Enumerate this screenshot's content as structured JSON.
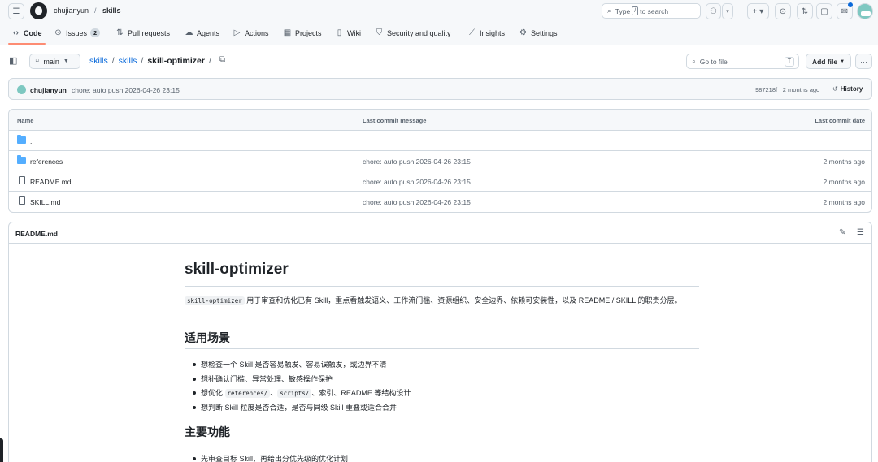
{
  "header": {
    "owner": "chujianyun",
    "separator": "/",
    "repo": "skills",
    "search_prefix": "Type",
    "search_key": "/",
    "search_suffix": "to search"
  },
  "tabs": [
    {
      "label": "Code",
      "icon": "code-icon"
    },
    {
      "label": "Issues",
      "icon": "issue-icon",
      "count": "2"
    },
    {
      "label": "Pull requests",
      "icon": "pull-request-icon"
    },
    {
      "label": "Agents",
      "icon": "agent-icon"
    },
    {
      "label": "Actions",
      "icon": "play-icon"
    },
    {
      "label": "Projects",
      "icon": "table-icon"
    },
    {
      "label": "Wiki",
      "icon": "book-icon"
    },
    {
      "label": "Security and quality",
      "icon": "shield-icon"
    },
    {
      "label": "Insights",
      "icon": "graph-icon"
    },
    {
      "label": "Settings",
      "icon": "gear-icon"
    }
  ],
  "pathbar": {
    "branch": "main",
    "path_1": "skills",
    "path_2": "skills",
    "current": "skill-optimizer",
    "trail_sep": "/",
    "goto_placeholder": "Go to file",
    "goto_key": "T",
    "add_file": "Add file"
  },
  "commit": {
    "author": "chujianyun",
    "message": "chore: auto push 2026-04-26 23:15",
    "meta": "987218f · 2 months ago",
    "history": "History"
  },
  "files": {
    "col_name": "Name",
    "col_message": "Last commit message",
    "col_date": "Last commit date",
    "parent": "..",
    "rows": [
      {
        "name": "references",
        "type": "folder",
        "message": "chore: auto push 2026-04-26 23:15",
        "date": "2 months ago"
      },
      {
        "name": "README.md",
        "type": "file",
        "message": "chore: auto push 2026-04-26 23:15",
        "date": "2 months ago"
      },
      {
        "name": "SKILL.md",
        "type": "file",
        "message": "chore: auto push 2026-04-26 23:15",
        "date": "2 months ago"
      }
    ]
  },
  "readme": {
    "filename": "README.md",
    "title": "skill-optimizer",
    "intro_code": "skill-optimizer",
    "intro_text": "用于审查和优化已有 Skill，重点看触发语义、工作流门槛、资源组织、安全边界、依赖可安装性，以及 README / SKILL 的职责分层。",
    "h2_usage": "适用场景",
    "usage_1": "想检查一个 Skill 是否容易触发、容易误触发，或边界不清",
    "usage_2": "想补确认门槛、异常处理、敏感操作保护",
    "usage_3_a": "想优化",
    "usage_3_code1": "references/",
    "usage_3_sep": "、",
    "usage_3_code2": "scripts/",
    "usage_3_b": "、索引、README 等结构设计",
    "usage_4": "想判断 Skill 粒度是否合适，是否与同级 Skill 重叠或适合合并",
    "h2_features": "主要功能",
    "feature_1": "先审查目标 Skill，再给出分优先级的优化计划"
  },
  "colors": {
    "link": "#0969da",
    "folder": "#54aeff",
    "tab_underline": "#fd8c73",
    "border": "#d1d9e0"
  }
}
